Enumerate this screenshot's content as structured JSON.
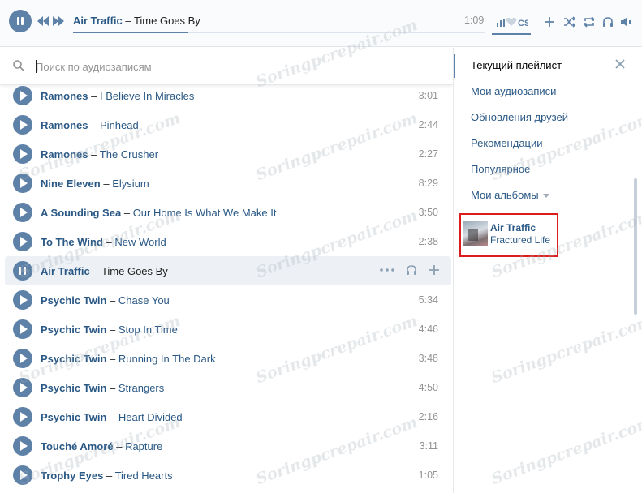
{
  "player": {
    "artist": "Air Traffic",
    "separator": "–",
    "song": "Time Goes By",
    "time": "1:09",
    "progress": 0.28,
    "icons": [
      "pause-icon",
      "prev-icon",
      "next-icon",
      "volume-heart-icon",
      "add-icon",
      "shuffle-icon",
      "repeat-icon",
      "headphones-icon",
      "speaker-icon"
    ]
  },
  "search": {
    "placeholder": "Поиск по аудиозаписям"
  },
  "tracks": [
    {
      "artist": "Ramones",
      "sep": "–",
      "title": "I Believe In Miracles",
      "duration": "3:01"
    },
    {
      "artist": "Ramones",
      "sep": "–",
      "title": "Pinhead",
      "duration": "2:44"
    },
    {
      "artist": "Ramones",
      "sep": "–",
      "title": "The Crusher",
      "duration": "2:27"
    },
    {
      "artist": "Nine Eleven",
      "sep": "–",
      "title": "Elysium",
      "duration": "8:29"
    },
    {
      "artist": "A Sounding Sea",
      "sep": "–",
      "title": "Our Home Is What We Make It",
      "duration": "3:50"
    },
    {
      "artist": "To The Wind",
      "sep": "–",
      "title": "New World",
      "duration": "2:38"
    },
    {
      "artist": "Air Traffic",
      "sep": "–",
      "title": "Time Goes By",
      "duration": "",
      "active": true
    },
    {
      "artist": "Psychic Twin",
      "sep": "–",
      "title": "Chase You",
      "duration": "5:34"
    },
    {
      "artist": "Psychic Twin",
      "sep": "–",
      "title": "Stop In Time",
      "duration": "4:46"
    },
    {
      "artist": "Psychic Twin",
      "sep": "–",
      "title": "Running In The Dark",
      "duration": "3:48"
    },
    {
      "artist": "Psychic Twin",
      "sep": "–",
      "title": "Strangers",
      "duration": "4:50"
    },
    {
      "artist": "Psychic Twin",
      "sep": "–",
      "title": "Heart Divided",
      "duration": "2:16"
    },
    {
      "artist": "Touché Amoré",
      "sep": "–",
      "title": "Rapture",
      "duration": "3:11"
    },
    {
      "artist": "Trophy Eyes",
      "sep": "–",
      "title": "Tired Hearts",
      "duration": "1:05"
    }
  ],
  "sidebar": {
    "current": "Текущий плейлист",
    "my_audio": "Мои аудиозаписи",
    "friends_updates": "Обновления друзей",
    "recommendations": "Рекомендации",
    "popular": "Популярное",
    "my_albums": "Мои альбомы",
    "album": {
      "artist": "Air Traffic",
      "title": "Fractured Life"
    }
  },
  "watermark": "Soringpcrepair.com",
  "colors": {
    "accent": "#5e81a8",
    "link": "#2a5885",
    "highlight_border": "#dc1c1c",
    "active_row": "#edf0f5"
  }
}
